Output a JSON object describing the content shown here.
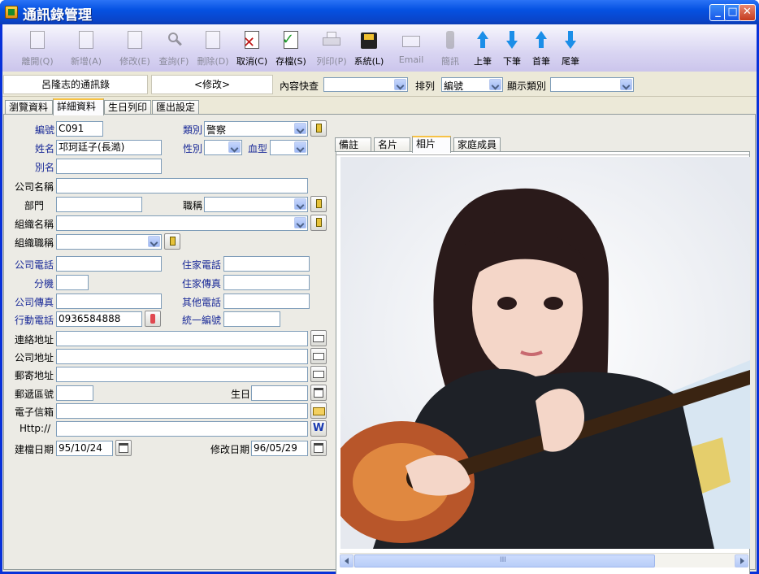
{
  "window": {
    "title": "通訊錄管理"
  },
  "toolbar": [
    {
      "label": "離開(Q)",
      "icon": "exit-icon",
      "disabled": true
    },
    {
      "label": "新增(A)",
      "icon": "add-icon",
      "disabled": true
    },
    {
      "label": "修改(E)",
      "icon": "edit-icon",
      "disabled": true
    },
    {
      "label": "查詢(F)",
      "icon": "query-icon",
      "disabled": true
    },
    {
      "label": "刪除(D)",
      "icon": "delete-icon",
      "disabled": true
    },
    {
      "label": "取消(C)",
      "icon": "cancel-icon",
      "disabled": false
    },
    {
      "label": "存檔(S)",
      "icon": "save-icon",
      "disabled": false
    },
    {
      "label": "列印(P)",
      "icon": "print-icon",
      "disabled": true
    },
    {
      "label": "系統(L)",
      "icon": "system-icon",
      "disabled": false
    },
    {
      "label": "Email",
      "icon": "email-icon",
      "disabled": true
    },
    {
      "label": "簡訊",
      "icon": "sms-icon",
      "disabled": true
    },
    {
      "label": "上筆",
      "icon": "prev-icon",
      "disabled": false
    },
    {
      "label": "下筆",
      "icon": "next-icon",
      "disabled": false
    },
    {
      "label": "首筆",
      "icon": "first-icon",
      "disabled": false
    },
    {
      "label": "尾筆",
      "icon": "last-icon",
      "disabled": false
    }
  ],
  "status": {
    "book": "呂隆志的通訊錄",
    "mode": "<修改>",
    "search_label": "內容快查",
    "sort_label": "排列",
    "sort_value": "編號",
    "category_label": "顯示類別",
    "search_value": "",
    "category_value": ""
  },
  "tabs": [
    "瀏覽資料",
    "詳細資料",
    "生日列印",
    "匯出設定"
  ],
  "form": {
    "id_label": "編號",
    "id": "C091",
    "category_label": "類別",
    "category": "警察",
    "name_label": "姓名",
    "name": "邛珂廷子(長澔)",
    "gender_label": "性別",
    "gender": "",
    "blood_label": "血型",
    "blood": "",
    "alias_label": "別名",
    "alias": "",
    "company_label": "公司名稱",
    "company": "",
    "dept_label": "部門",
    "dept": "",
    "title_label": "職稱",
    "title": "",
    "org_label": "組織名稱",
    "org": "",
    "org_title_label": "組織職稱",
    "org_title": "",
    "office_phone_label": "公司電話",
    "office_phone": "",
    "home_phone_label": "住家電話",
    "home_phone": "",
    "ext_label": "分機",
    "ext": "",
    "home_fax_label": "住家傳真",
    "home_fax": "",
    "office_fax_label": "公司傳真",
    "office_fax": "",
    "other_phone_label": "其他電話",
    "other_phone": "",
    "mobile_label": "行動電話",
    "mobile": "0936584888",
    "tax_id_label": "統一編號",
    "tax_id": "",
    "contact_addr_label": "連絡地址",
    "contact_addr": "",
    "company_addr_label": "公司地址",
    "company_addr": "",
    "mail_addr_label": "郵寄地址",
    "mail_addr": "",
    "zip_label": "郵遞區號",
    "zip": "",
    "birthday_label": "生日",
    "birthday": "",
    "email_label": "電子信箱",
    "email": "",
    "http_label": "Http://",
    "http": "",
    "created_label": "建檔日期",
    "created": "95/10/24",
    "modified_label": "修改日期",
    "modified": "96/05/29"
  },
  "right_tabs": [
    "備註",
    "名片",
    "相片",
    "家庭成員"
  ],
  "scroll_grip": "III"
}
